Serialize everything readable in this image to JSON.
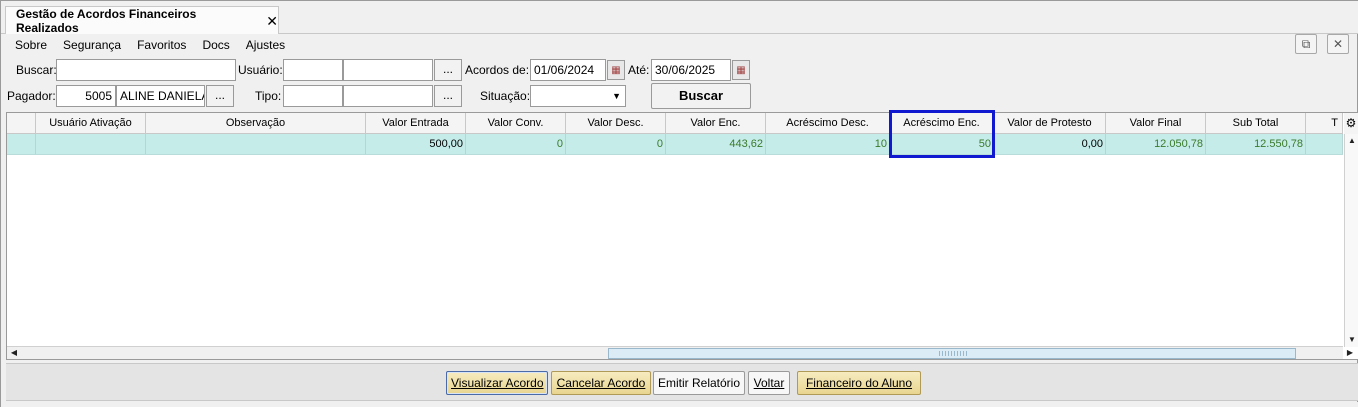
{
  "tab": {
    "title": "Gestão de Acordos Financeiros Realizados",
    "close_glyph": "✕"
  },
  "menu": [
    "Sobre",
    "Segurança",
    "Favoritos",
    "Docs",
    "Ajustes"
  ],
  "window_buttons": {
    "popout_glyph": "⧉",
    "close_glyph": "✕"
  },
  "filters": {
    "buscar_label": "Buscar:",
    "buscar_value": "",
    "usuario_label": "Usuário:",
    "usuario_code": "",
    "usuario_name": "",
    "acordos_de_label": "Acordos de:",
    "acordos_de_value": "01/06/2024",
    "ate_label": "Até:",
    "ate_value": "30/06/2025",
    "pagador_label": "Pagador:",
    "pagador_code": "5005",
    "pagador_name": "ALINE DANIELA",
    "tipo_label": "Tipo:",
    "tipo_code": "",
    "tipo_name": "",
    "situacao_label": "Situação:",
    "situacao_value": "",
    "dots": "...",
    "buscar_button": "Buscar"
  },
  "grid": {
    "columns": [
      "Usuário Ativação",
      "Observação",
      "Valor Entrada",
      "Valor Conv.",
      "Valor Desc.",
      "Valor Enc.",
      "Acréscimo Desc.",
      "Acréscimo Enc.",
      "Valor de Protesto",
      "Valor Final",
      "Sub Total",
      "T"
    ],
    "rows": [
      [
        "",
        "",
        "500,00",
        "0",
        "0",
        "443,62",
        "10",
        "50",
        "0,00",
        "12.050,78",
        "12.550,78",
        ""
      ]
    ]
  },
  "footer": {
    "visualizar": "Visualizar Acordo",
    "cancelar": "Cancelar Acordo",
    "emitir": "Emitir Relatório",
    "voltar": "Voltar",
    "financeiro": "Financeiro do Aluno"
  }
}
